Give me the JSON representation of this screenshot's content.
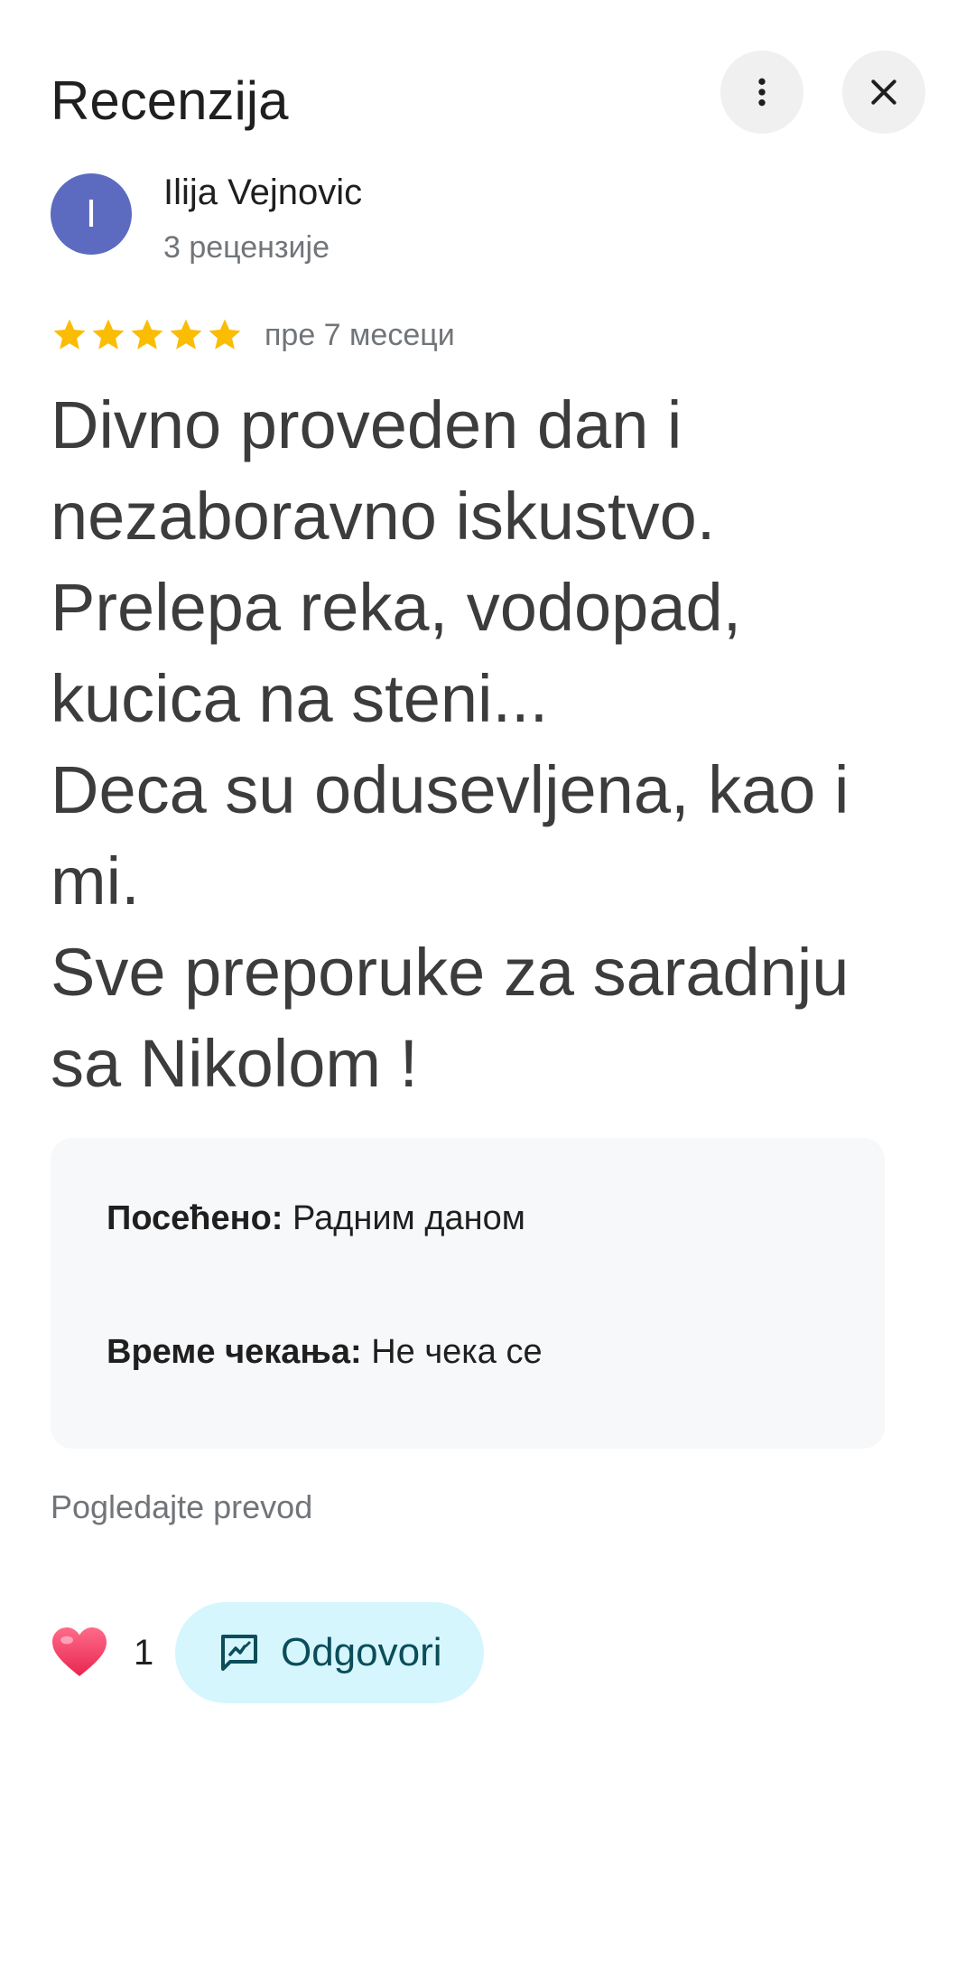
{
  "header": {
    "title": "Recenzija",
    "more_icon": "more-vert-icon",
    "close_icon": "close-icon"
  },
  "author": {
    "initial": "I",
    "name": "Ilija Vejnovic",
    "meta": "3 рецензије",
    "avatar_color": "#5c6bc0"
  },
  "review": {
    "rating": 5,
    "max_rating": 5,
    "star_color": "#fbbc04",
    "date": "пре 7 месеци",
    "text": "Divno proveden dan i nezaboravno iskustvo.\nPrelepa reka, vodopad, kucica na steni...\nDeca su odusevljena, kao i mi.\nSve preporuke za saradnju sa Nikolom !"
  },
  "details": [
    {
      "label": "Посећено:",
      "value": "Радним даном"
    },
    {
      "label": "Време чекања:",
      "value": "Не чека се"
    }
  ],
  "translate_link": "Pogledajte prevod",
  "actions": {
    "like_icon": "heart-icon",
    "like_count": "1",
    "reply_icon": "reply-icon",
    "reply_label": "Odgovori",
    "reply_bg": "#d5f6fc"
  }
}
